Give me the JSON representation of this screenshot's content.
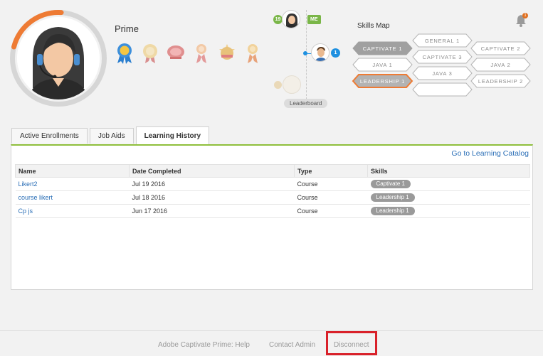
{
  "profile": {
    "name": "Prime",
    "progress": 0.22,
    "progress_color": "#ee7b34",
    "badges": [
      "ribbon-rosette-blue",
      "medal-gold",
      "medal-red",
      "ribbon-pink",
      "medal-star-gold",
      "ribbon-orange"
    ]
  },
  "leaderboard": {
    "me_rank": "19",
    "me_tag": "ME",
    "top_rank": "1",
    "label": "Leaderboard"
  },
  "skills_map": {
    "title": "Skills Map",
    "notification_count": "1",
    "skills": [
      {
        "label": "GENERAL 1",
        "state": "outline"
      },
      {
        "label": "CAPTIVATE 1",
        "state": "filled"
      },
      {
        "label": "CAPTIVATE 3",
        "state": "outline"
      },
      {
        "label": "CAPTIVATE 2",
        "state": "outline"
      },
      {
        "label": "JAVA 1",
        "state": "outline"
      },
      {
        "label": "JAVA 3",
        "state": "outline"
      },
      {
        "label": "JAVA 2",
        "state": "outline"
      },
      {
        "label": "LEADERSHIP 1",
        "state": "highlight"
      },
      {
        "label": "LEADERSHIP 2",
        "state": "outline"
      },
      {
        "label": "",
        "state": "outline"
      }
    ]
  },
  "tabs": [
    {
      "label": "Active Enrollments",
      "active": false
    },
    {
      "label": "Job Aids",
      "active": false
    },
    {
      "label": "Learning History",
      "active": true
    }
  ],
  "catalog_link": "Go to Learning Catalog",
  "table": {
    "headers": [
      "Name",
      "Date Completed",
      "Type",
      "Skills"
    ],
    "rows": [
      {
        "name": "Likert2",
        "date": "Jul 19 2016",
        "type": "Course",
        "skill": "Captivate 1"
      },
      {
        "name": "course likert",
        "date": "Jul 18 2016",
        "type": "Course",
        "skill": "Leadership 1"
      },
      {
        "name": "Cp js",
        "date": "Jun 17 2016",
        "type": "Course",
        "skill": "Leadership 1"
      }
    ]
  },
  "footer": {
    "help": "Adobe Captivate Prime: Help",
    "contact": "Contact Admin",
    "disconnect": "Disconnect",
    "highlight_color": "#d9212a"
  }
}
